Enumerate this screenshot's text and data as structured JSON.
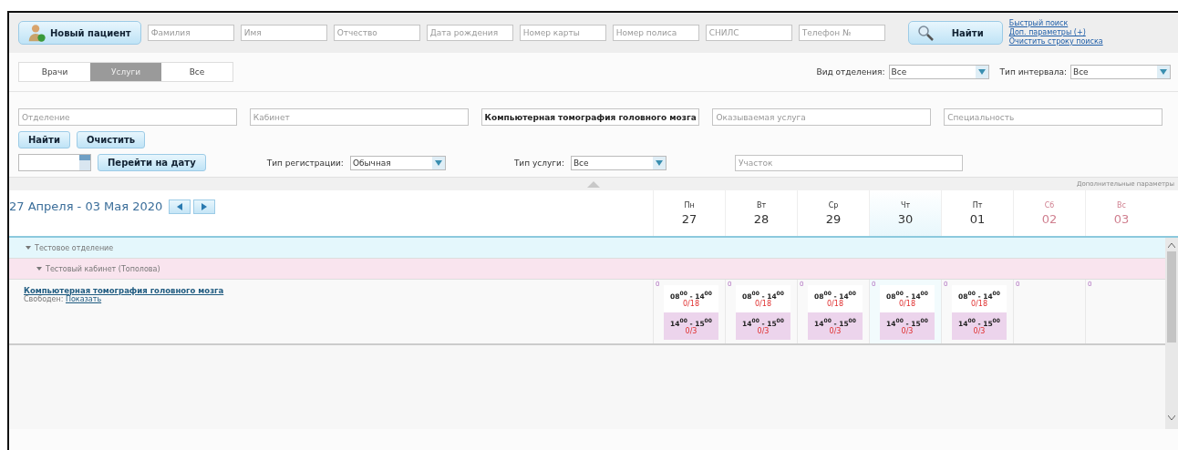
{
  "top_bar": {
    "new_patient_button": "Новый пациент",
    "search_fields": [
      {
        "placeholder": "Фамилия"
      },
      {
        "placeholder": "Имя"
      },
      {
        "placeholder": "Отчество"
      },
      {
        "placeholder": "Дата рождения"
      },
      {
        "placeholder": "Номер карты"
      },
      {
        "placeholder": "Номер полиса"
      },
      {
        "placeholder": "СНИЛС"
      },
      {
        "placeholder": "Телефон №"
      }
    ],
    "find_button": "Найти",
    "links": [
      "Быстрый поиск",
      "Доп. параметры (+)",
      "Очистить строку поиска"
    ]
  },
  "view_tabs": [
    {
      "label": "Врачи",
      "selected": false
    },
    {
      "label": "Услуги",
      "selected": true
    },
    {
      "label": "Все",
      "selected": false
    }
  ],
  "view_filters": [
    {
      "label": "Вид отделения:",
      "value": "Все"
    },
    {
      "label": "Тип интервала:",
      "value": "Все"
    }
  ],
  "service_filters": [
    {
      "placeholder": "Отделение"
    },
    {
      "placeholder": "Кабинет"
    },
    {
      "value": "Компьютерная томография головного мозга"
    },
    {
      "placeholder": "Оказываемая услуга"
    },
    {
      "placeholder": "Специальность"
    }
  ],
  "filter_buttons": [
    "Найти",
    "Очистить"
  ],
  "goto_date_button": "Перейти на дату",
  "date_filters": [
    {
      "label": "Тип регистрации:",
      "value": "Обычная"
    },
    {
      "label": "Тип услуги:",
      "value": "Все"
    }
  ],
  "area_field": {
    "placeholder": "Участок"
  },
  "extra_params_link": "Дополнительные параметры",
  "calendar": {
    "range": "27 Апреля - 03 Мая 2020",
    "days": [
      {
        "weekday": "Пн",
        "date": "27",
        "today": false,
        "weekend": false
      },
      {
        "weekday": "Вт",
        "date": "28",
        "today": false,
        "weekend": false
      },
      {
        "weekday": "Ср",
        "date": "29",
        "today": false,
        "weekend": false
      },
      {
        "weekday": "Чт",
        "date": "30",
        "today": true,
        "weekend": false
      },
      {
        "weekday": "Пт",
        "date": "01",
        "today": false,
        "weekend": false
      },
      {
        "weekday": "Сб",
        "date": "02",
        "today": false,
        "weekend": true
      },
      {
        "weekday": "Вс",
        "date": "03",
        "today": false,
        "weekend": true
      }
    ],
    "tree": [
      {
        "label": "Тестовое отделение",
        "expanded": true,
        "children": [
          {
            "label": "Тестовый кабинет (Тополова)",
            "expanded": true,
            "children": [
              {
                "service": "Компьютерная томография головного мозга",
                "free_label": "Свободен:",
                "show_link": "Показать",
                "schedule": [
                  {
                    "free": "0",
                    "slots": [
                      {
                        "kind": "day",
                        "time": "08$^{00}$ - 14$^{00}$",
                        "count": "0/18"
                      },
                      {
                        "kind": "evening",
                        "time": "14$^{00}$ - 15$^{00}$",
                        "count": "0/3"
                      }
                    ]
                  },
                  {
                    "free": "0",
                    "slots": [
                      {
                        "kind": "day",
                        "time": "08$^{00}$ - 14$^{00}$",
                        "count": "0/18"
                      },
                      {
                        "kind": "evening",
                        "time": "14$^{00}$ - 15$^{00}$",
                        "count": "0/3"
                      }
                    ]
                  },
                  {
                    "free": "0",
                    "slots": [
                      {
                        "kind": "day",
                        "time": "08$^{00}$ - 14$^{00}$",
                        "count": "0/18"
                      },
                      {
                        "kind": "evening",
                        "time": "14$^{00}$ - 15$^{00}$",
                        "count": "0/3"
                      }
                    ]
                  },
                  {
                    "free": "0",
                    "slots": [
                      {
                        "kind": "day",
                        "time": "08$^{00}$ - 14$^{00}$",
                        "count": "0/18"
                      },
                      {
                        "kind": "evening",
                        "time": "14$^{00}$ - 15$^{00}$",
                        "count": "0/3"
                      }
                    ]
                  },
                  {
                    "free": "0",
                    "slots": [
                      {
                        "kind": "day",
                        "time": "08$^{00}$ - 14$^{00}$",
                        "count": "0/18"
                      },
                      {
                        "kind": "evening",
                        "time": "14$^{00}$ - 15$^{00}$",
                        "count": "0/3"
                      }
                    ]
                  },
                  {
                    "free": "0"
                  },
                  {
                    "free": "0"
                  }
                ]
              }
            ]
          }
        ]
      }
    ]
  }
}
